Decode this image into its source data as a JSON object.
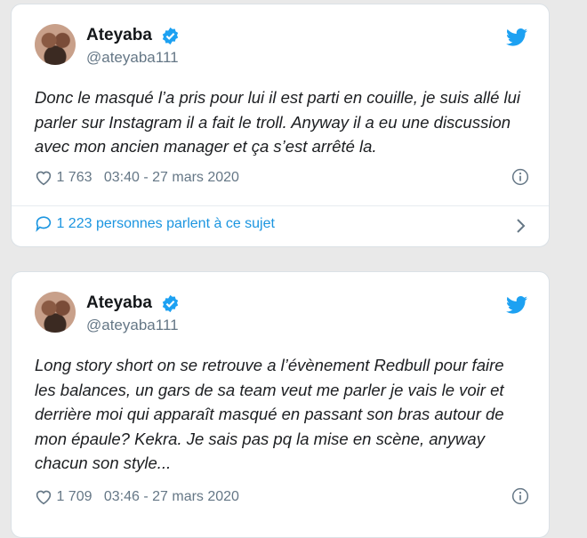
{
  "tweets": [
    {
      "name": "Ateyaba",
      "handle": "@ateyaba111",
      "text": "Donc le masqué l’a pris pour lui il est parti en couille, je suis allé lui parler sur Instagram il a fait le troll. Anyway il a eu une discussion avec mon ancien manager et ça s’est arrêté la.",
      "likes": "1 763",
      "timestamp": "03:40 - 27 mars 2020",
      "conversation": "1 223 personnes parlent à ce sujet"
    },
    {
      "name": "Ateyaba",
      "handle": "@ateyaba111",
      "text": "Long story short on se retrouve a l’évènement Redbull pour faire les balances, un gars de sa team veut me parler je vais le voir et derrière moi qui apparaît masqué en passant son bras autour de mon épaule? Kekra. Je sais pas pq la mise en scène, anyway chacun son style...",
      "likes": "1 709",
      "timestamp": "03:46 - 27 mars 2020"
    }
  ],
  "icons": {
    "verified": "verified-badge-icon",
    "twitter": "twitter-bird-icon",
    "like": "heart-icon",
    "info": "info-icon",
    "reply": "speech-bubble-icon",
    "more": "chevron-right-icon"
  },
  "colors": {
    "twitter_blue": "#1da1f2",
    "link_blue": "#1b95e0",
    "muted": "#657786"
  }
}
